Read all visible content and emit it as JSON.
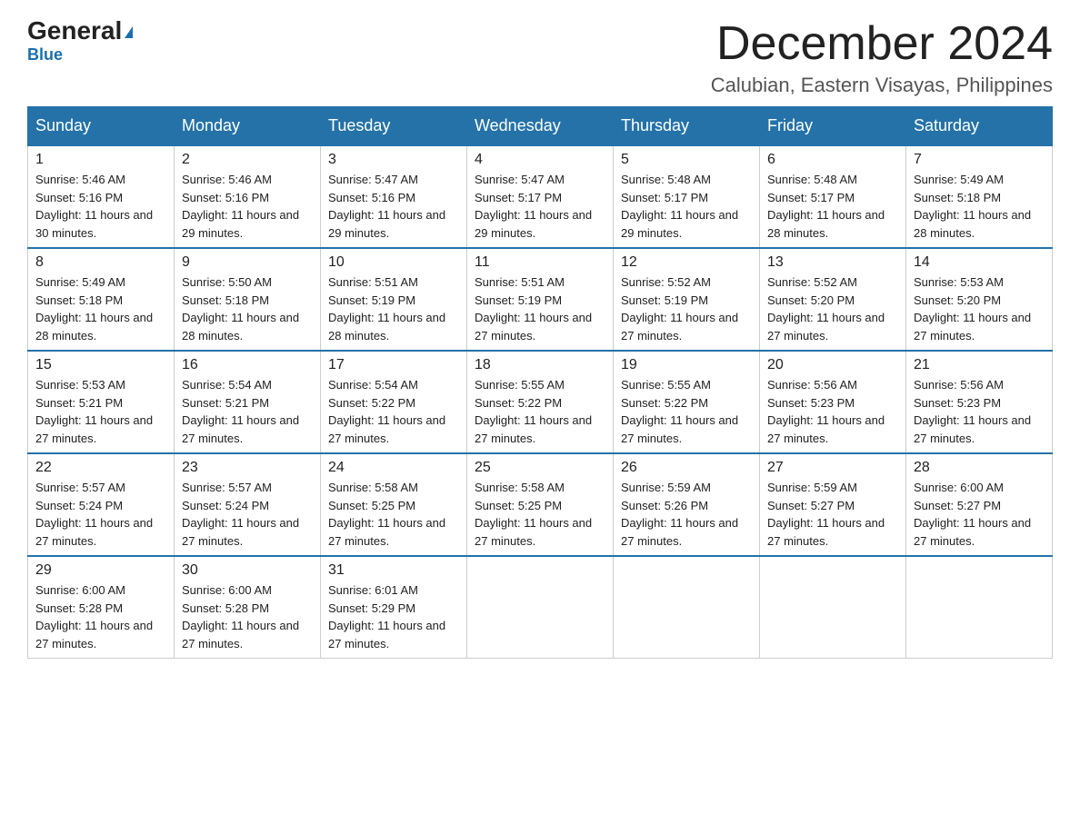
{
  "logo": {
    "general": "General",
    "triangle": "▶",
    "blue": "Blue"
  },
  "header": {
    "month": "December 2024",
    "location": "Calubian, Eastern Visayas, Philippines"
  },
  "days_of_week": [
    "Sunday",
    "Monday",
    "Tuesday",
    "Wednesday",
    "Thursday",
    "Friday",
    "Saturday"
  ],
  "weeks": [
    [
      {
        "day": "1",
        "sunrise": "5:46 AM",
        "sunset": "5:16 PM",
        "daylight": "11 hours and 30 minutes."
      },
      {
        "day": "2",
        "sunrise": "5:46 AM",
        "sunset": "5:16 PM",
        "daylight": "11 hours and 29 minutes."
      },
      {
        "day": "3",
        "sunrise": "5:47 AM",
        "sunset": "5:16 PM",
        "daylight": "11 hours and 29 minutes."
      },
      {
        "day": "4",
        "sunrise": "5:47 AM",
        "sunset": "5:17 PM",
        "daylight": "11 hours and 29 minutes."
      },
      {
        "day": "5",
        "sunrise": "5:48 AM",
        "sunset": "5:17 PM",
        "daylight": "11 hours and 29 minutes."
      },
      {
        "day": "6",
        "sunrise": "5:48 AM",
        "sunset": "5:17 PM",
        "daylight": "11 hours and 28 minutes."
      },
      {
        "day": "7",
        "sunrise": "5:49 AM",
        "sunset": "5:18 PM",
        "daylight": "11 hours and 28 minutes."
      }
    ],
    [
      {
        "day": "8",
        "sunrise": "5:49 AM",
        "sunset": "5:18 PM",
        "daylight": "11 hours and 28 minutes."
      },
      {
        "day": "9",
        "sunrise": "5:50 AM",
        "sunset": "5:18 PM",
        "daylight": "11 hours and 28 minutes."
      },
      {
        "day": "10",
        "sunrise": "5:51 AM",
        "sunset": "5:19 PM",
        "daylight": "11 hours and 28 minutes."
      },
      {
        "day": "11",
        "sunrise": "5:51 AM",
        "sunset": "5:19 PM",
        "daylight": "11 hours and 27 minutes."
      },
      {
        "day": "12",
        "sunrise": "5:52 AM",
        "sunset": "5:19 PM",
        "daylight": "11 hours and 27 minutes."
      },
      {
        "day": "13",
        "sunrise": "5:52 AM",
        "sunset": "5:20 PM",
        "daylight": "11 hours and 27 minutes."
      },
      {
        "day": "14",
        "sunrise": "5:53 AM",
        "sunset": "5:20 PM",
        "daylight": "11 hours and 27 minutes."
      }
    ],
    [
      {
        "day": "15",
        "sunrise": "5:53 AM",
        "sunset": "5:21 PM",
        "daylight": "11 hours and 27 minutes."
      },
      {
        "day": "16",
        "sunrise": "5:54 AM",
        "sunset": "5:21 PM",
        "daylight": "11 hours and 27 minutes."
      },
      {
        "day": "17",
        "sunrise": "5:54 AM",
        "sunset": "5:22 PM",
        "daylight": "11 hours and 27 minutes."
      },
      {
        "day": "18",
        "sunrise": "5:55 AM",
        "sunset": "5:22 PM",
        "daylight": "11 hours and 27 minutes."
      },
      {
        "day": "19",
        "sunrise": "5:55 AM",
        "sunset": "5:22 PM",
        "daylight": "11 hours and 27 minutes."
      },
      {
        "day": "20",
        "sunrise": "5:56 AM",
        "sunset": "5:23 PM",
        "daylight": "11 hours and 27 minutes."
      },
      {
        "day": "21",
        "sunrise": "5:56 AM",
        "sunset": "5:23 PM",
        "daylight": "11 hours and 27 minutes."
      }
    ],
    [
      {
        "day": "22",
        "sunrise": "5:57 AM",
        "sunset": "5:24 PM",
        "daylight": "11 hours and 27 minutes."
      },
      {
        "day": "23",
        "sunrise": "5:57 AM",
        "sunset": "5:24 PM",
        "daylight": "11 hours and 27 minutes."
      },
      {
        "day": "24",
        "sunrise": "5:58 AM",
        "sunset": "5:25 PM",
        "daylight": "11 hours and 27 minutes."
      },
      {
        "day": "25",
        "sunrise": "5:58 AM",
        "sunset": "5:25 PM",
        "daylight": "11 hours and 27 minutes."
      },
      {
        "day": "26",
        "sunrise": "5:59 AM",
        "sunset": "5:26 PM",
        "daylight": "11 hours and 27 minutes."
      },
      {
        "day": "27",
        "sunrise": "5:59 AM",
        "sunset": "5:27 PM",
        "daylight": "11 hours and 27 minutes."
      },
      {
        "day": "28",
        "sunrise": "6:00 AM",
        "sunset": "5:27 PM",
        "daylight": "11 hours and 27 minutes."
      }
    ],
    [
      {
        "day": "29",
        "sunrise": "6:00 AM",
        "sunset": "5:28 PM",
        "daylight": "11 hours and 27 minutes."
      },
      {
        "day": "30",
        "sunrise": "6:00 AM",
        "sunset": "5:28 PM",
        "daylight": "11 hours and 27 minutes."
      },
      {
        "day": "31",
        "sunrise": "6:01 AM",
        "sunset": "5:29 PM",
        "daylight": "11 hours and 27 minutes."
      },
      null,
      null,
      null,
      null
    ]
  ]
}
